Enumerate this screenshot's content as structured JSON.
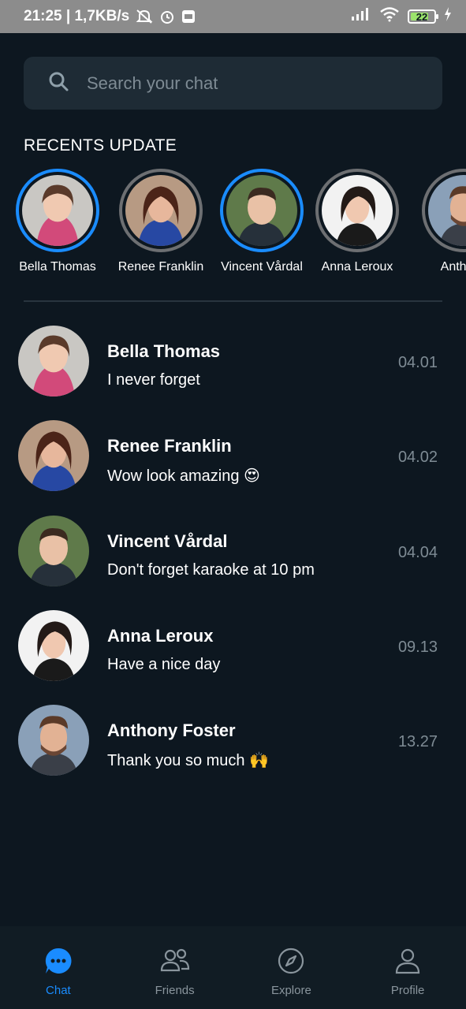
{
  "status_bar": {
    "time_speed": "21:25 | 1,7KB/s",
    "battery": "22"
  },
  "search": {
    "placeholder": "Search your chat"
  },
  "recents": {
    "title": "RECENTS UPDATE",
    "stories": [
      {
        "name": "Bella Thomas",
        "active": true
      },
      {
        "name": "Renee Franklin",
        "active": false
      },
      {
        "name": "Vincent Vårdal",
        "active": true
      },
      {
        "name": "Anna Leroux",
        "active": false
      },
      {
        "name": "Anthony",
        "active": false
      }
    ]
  },
  "chats": [
    {
      "name": "Bella Thomas",
      "message": "I never forget",
      "emoji": "",
      "time": "04.01"
    },
    {
      "name": "Renee Franklin",
      "message": "Wow look amazing",
      "emoji": "😍",
      "time": "04.02"
    },
    {
      "name": "Vincent Vårdal",
      "message": "Don't forget karaoke at 10 pm",
      "emoji": "",
      "time": "04.04"
    },
    {
      "name": "Anna Leroux",
      "message": "Have a nice day",
      "emoji": "",
      "time": "09.13"
    },
    {
      "name": "Anthony Foster",
      "message": "Thank you so much",
      "emoji": "🙌",
      "time": "13.27"
    }
  ],
  "nav": {
    "chat": "Chat",
    "friends": "Friends",
    "explore": "Explore",
    "profile": "Profile"
  },
  "colors": {
    "background": "#0d1720",
    "accent": "#1a8cff",
    "muted": "#7e8b94",
    "search_bg": "#1e2b35"
  }
}
